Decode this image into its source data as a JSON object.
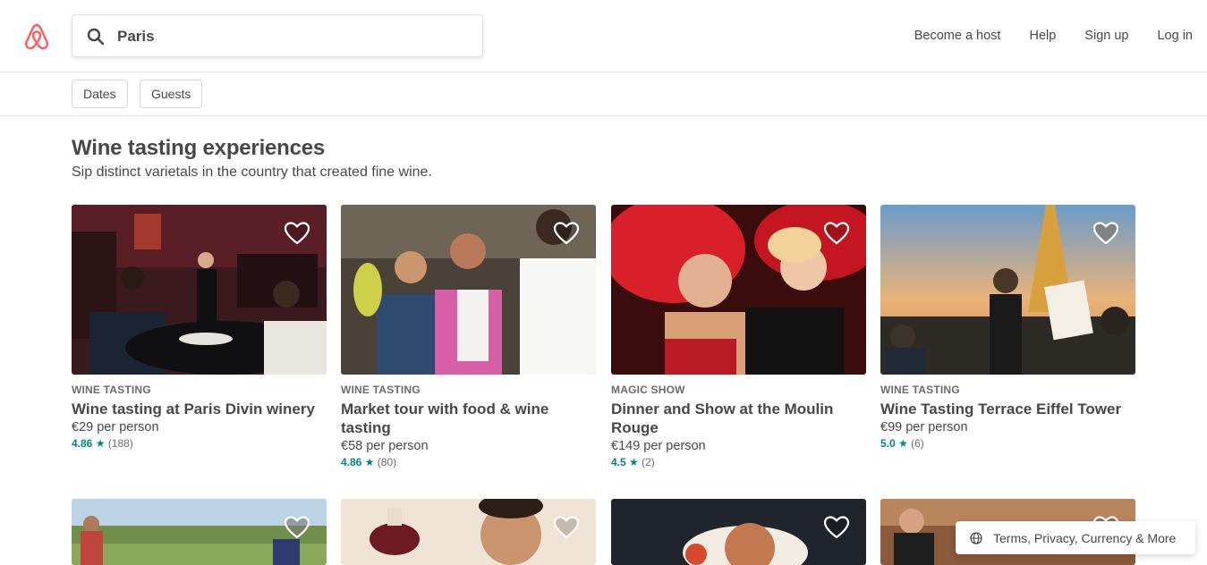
{
  "search": {
    "value": "Paris"
  },
  "nav": {
    "become_host": "Become a host",
    "help": "Help",
    "sign_up": "Sign up",
    "log_in": "Log in"
  },
  "filters": {
    "dates": "Dates",
    "guests": "Guests"
  },
  "section": {
    "title": "Wine tasting experiences",
    "subtitle": "Sip distinct varietals in the country that created fine wine."
  },
  "cards": [
    {
      "category": "WINE TASTING",
      "title": "Wine tasting at Paris Divin winery",
      "price": "€29 per person",
      "score": "4.86",
      "count": "(188)",
      "saved": false
    },
    {
      "category": "WINE TASTING",
      "title": "Market tour with food & wine tasting",
      "price": "€58 per person",
      "score": "4.86",
      "count": "(80)",
      "saved": false
    },
    {
      "category": "MAGIC SHOW",
      "title": "Dinner and Show at the Moulin Rouge",
      "price": "€149 per person",
      "score": "4.5",
      "count": "(2)",
      "saved": false
    },
    {
      "category": "WINE TASTING",
      "title": "Wine Tasting Terrace Eiffel Tower",
      "price": "€99 per person",
      "score": "5.0",
      "count": "(6)",
      "saved": false
    }
  ],
  "footer": {
    "label": "Terms, Privacy, Currency & More"
  },
  "colors": {
    "brand": "#FF5A5F",
    "rating": "#008489",
    "text": "#484848"
  }
}
